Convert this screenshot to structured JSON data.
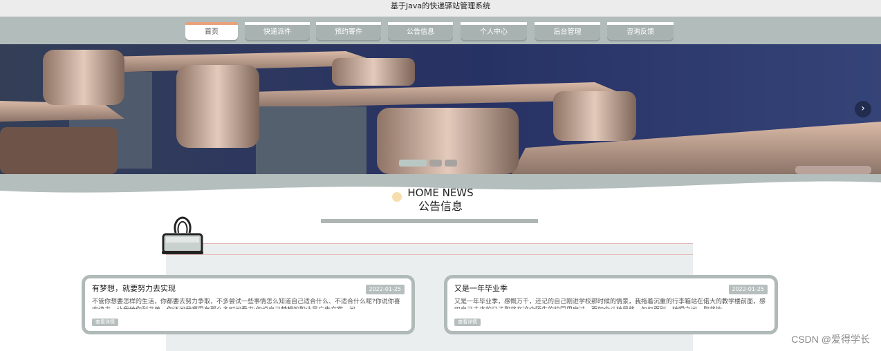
{
  "site": {
    "title": "基于Java的快递驿站管理系统"
  },
  "nav": {
    "items": [
      {
        "label": "首页",
        "active": true
      },
      {
        "label": "快递派件"
      },
      {
        "label": "预约寄件"
      },
      {
        "label": "公告信息"
      },
      {
        "label": "个人中心"
      },
      {
        "label": "后台管理"
      },
      {
        "label": "咨询反馈"
      }
    ]
  },
  "banner": {
    "next_icon": "chevron-right-icon",
    "slides": 3,
    "active_slide": 1
  },
  "news": {
    "heading_en": "HOME NEWS",
    "heading_cn": "公告信息",
    "cards": [
      {
        "title": "有梦想，就要努力去实现",
        "date": "2022-01-25",
        "text": "不管你想要怎样的生活，你都要去努力争取，不多尝试一些事情怎么知道自己适合什么、不适合什么呢?你说你喜欢读书，让我给你列书单，你还问我哪里有那么多时间看书;你说自己梦想的职业是广告文案，问",
        "more": "查看详情"
      },
      {
        "title": "又是一年毕业季",
        "date": "2022-01-25",
        "text": "又是一年毕业季，感慨万千，还记的自己刚进学校那时候的情景，我拖着沉重的行李箱站在偌大的教学楼前面，感叹自己未来的日子即将在这个陌生的校园里度过，而如今斗转星移，匆匆而别，转瞬之间，即将毕",
        "more": "查看详情"
      }
    ]
  },
  "watermark": "CSDN @爱得学长",
  "colors": {
    "nav_bg": "#b2bcba",
    "accent": "#e8a17b",
    "card_border": "#b0bab8"
  }
}
